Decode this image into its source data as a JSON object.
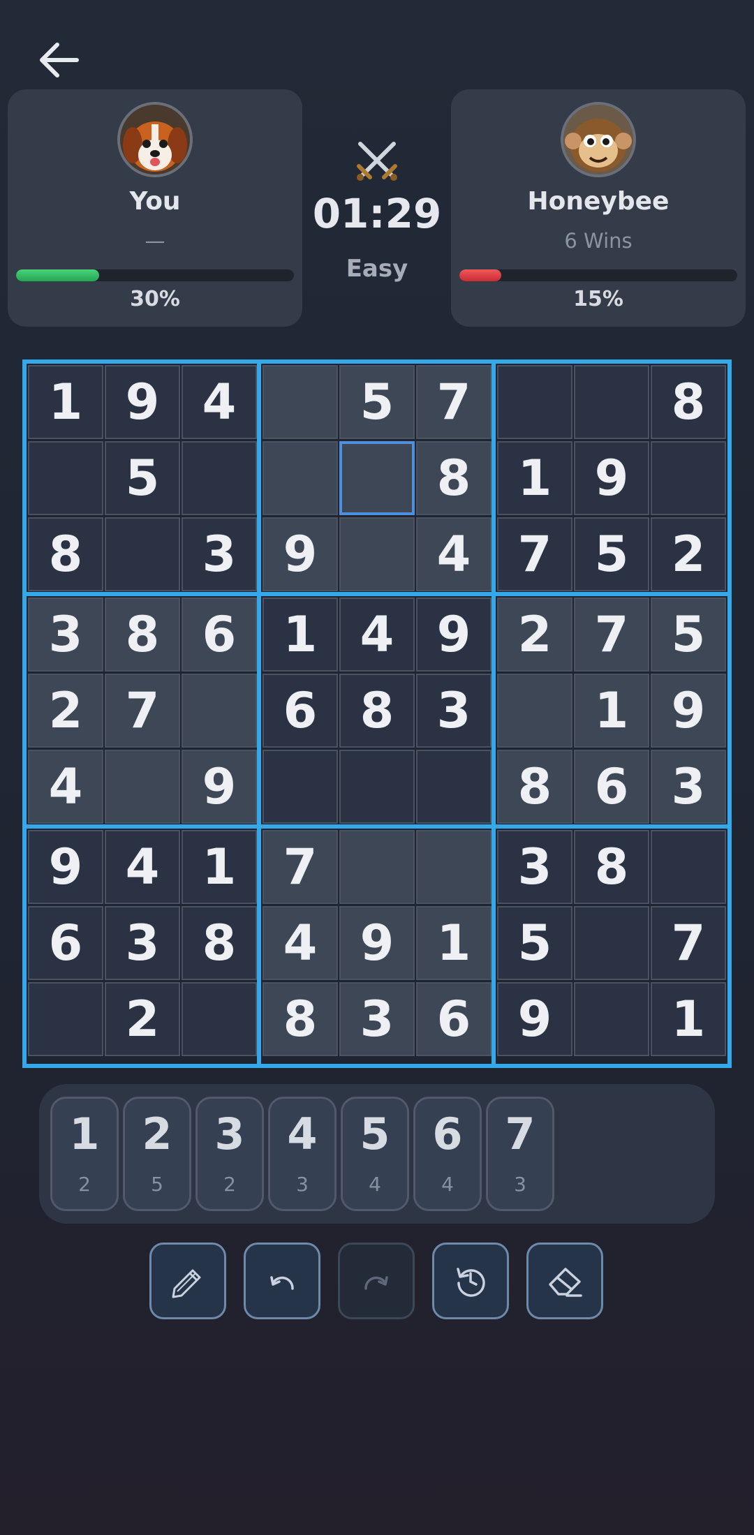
{
  "players": [
    {
      "name": "You",
      "subtitle": "—",
      "progress_percent": 30,
      "progress_label": "30%",
      "bar_color": "#3ac66a",
      "avatar": "puppy-avatar"
    },
    {
      "name": "Honeybee",
      "subtitle": "6 Wins",
      "progress_percent": 15,
      "progress_label": "15%",
      "bar_color": "#e0454a",
      "avatar": "monkey-avatar"
    }
  ],
  "match": {
    "timer": "01:29",
    "difficulty": "Easy",
    "icon": "crossed-swords-icon"
  },
  "board": {
    "rows": [
      [
        "1",
        "9",
        "4",
        "",
        "5",
        "7",
        "",
        "",
        "8"
      ],
      [
        "",
        "5",
        "",
        "",
        "",
        "8",
        "1",
        "9",
        ""
      ],
      [
        "8",
        "",
        "3",
        "9",
        "",
        "4",
        "7",
        "5",
        "2"
      ],
      [
        "3",
        "8",
        "6",
        "1",
        "4",
        "9",
        "2",
        "7",
        "5"
      ],
      [
        "2",
        "7",
        "",
        "6",
        "8",
        "3",
        "",
        "1",
        "9"
      ],
      [
        "4",
        "",
        "9",
        "",
        "",
        "",
        "8",
        "6",
        "3"
      ],
      [
        "9",
        "4",
        "1",
        "7",
        "",
        "",
        "3",
        "8",
        ""
      ],
      [
        "6",
        "3",
        "8",
        "4",
        "9",
        "1",
        "5",
        "",
        "7"
      ],
      [
        "",
        "2",
        "",
        "8",
        "3",
        "6",
        "9",
        "",
        "1"
      ]
    ],
    "selected": [
      1,
      4
    ],
    "accent_color": "#34a8e8"
  },
  "numpad": [
    {
      "digit": "1",
      "remaining": "2"
    },
    {
      "digit": "2",
      "remaining": "5"
    },
    {
      "digit": "3",
      "remaining": "2"
    },
    {
      "digit": "4",
      "remaining": "3"
    },
    {
      "digit": "5",
      "remaining": "4"
    },
    {
      "digit": "6",
      "remaining": "4"
    },
    {
      "digit": "7",
      "remaining": "3"
    }
  ],
  "tools": [
    "pencil-icon",
    "undo-icon",
    "redo-icon",
    "restart-icon",
    "eraser-icon"
  ]
}
